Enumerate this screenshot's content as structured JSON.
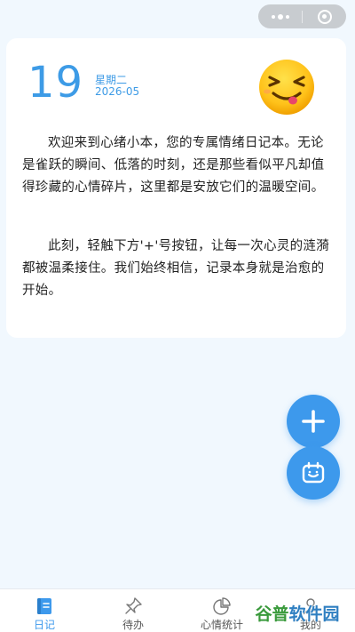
{
  "capsule": {
    "more_icon": "ellipsis-icon",
    "close_icon": "target-close-icon"
  },
  "diary": {
    "day": "19",
    "weekday": "星期二",
    "year_month": "2026-05",
    "mood_icon": "laughing-emoji-icon",
    "paragraph_1": "欢迎来到心绪小本，您的专属情绪日记本。无论是雀跃的瞬间、低落的时刻，还是那些看似平凡却值得珍藏的心情碎片，这里都是安放它们的温暖空间。",
    "paragraph_2": "此刻，轻触下方'+'号按钮，让每一次心灵的涟漪都被温柔接住。我们始终相信，记录本身就是治愈的开始。"
  },
  "fabs": {
    "add_icon": "plus-icon",
    "calendar_icon": "calendar-icon"
  },
  "tabbar": {
    "items": [
      {
        "label": "日记",
        "icon": "diary-icon",
        "active": true
      },
      {
        "label": "待办",
        "icon": "pin-icon",
        "active": false
      },
      {
        "label": "心情统计",
        "icon": "pie-chart-icon",
        "active": false
      },
      {
        "label": "我的",
        "icon": "user-icon",
        "active": false
      }
    ]
  },
  "watermark": {
    "part1": "谷普",
    "part2": "软件园"
  },
  "colors": {
    "accent": "#3d99ec",
    "background": "#f1f8fe"
  }
}
